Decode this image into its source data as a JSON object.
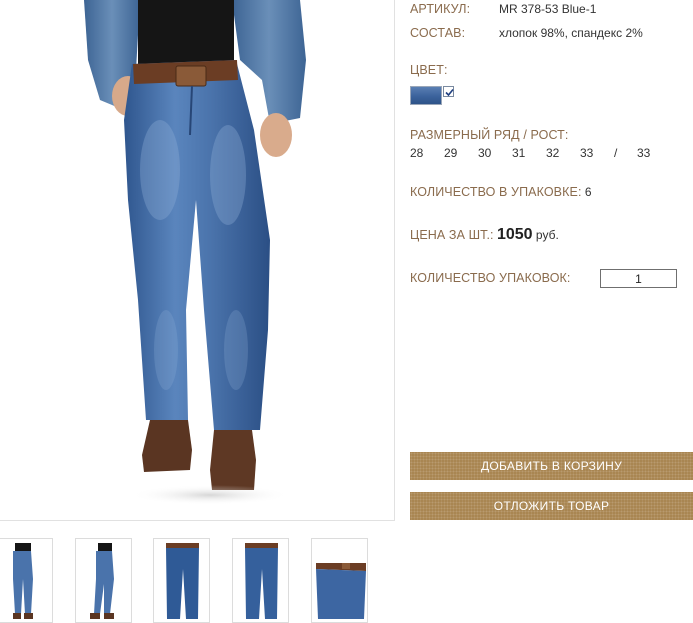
{
  "product": {
    "article_label": "АРТИКУЛ:",
    "article_value": "MR 378-53 Blue-1",
    "composition_label": "СОСТАВ:",
    "composition_value": "хлопок 98%, спандекс 2%",
    "color_label": "ЦВЕТ:",
    "color_swatch": "#3f66a0",
    "size_label": "РАЗМЕРНЫЙ РЯД / РОСТ:",
    "sizes": [
      "28",
      "29",
      "30",
      "31",
      "32",
      "33",
      "/",
      "33"
    ],
    "pack_qty_label": "КОЛИЧЕСТВО В УПАКОВКЕ:",
    "pack_qty_value": "6",
    "price_label": "ЦЕНА ЗА ШТ.:",
    "price_value": "1050",
    "price_currency": "руб.",
    "packs_label": "КОЛИЧЕСТВО УПАКОВОК:",
    "packs_value": "1"
  },
  "actions": {
    "add_to_cart": "ДОБАВИТЬ В КОРЗИНУ",
    "postpone": "ОТЛОЖИТЬ ТОВАР"
  },
  "colors": {
    "label": "#8a6b4d",
    "button": "#a8844f",
    "denim": "#3f66a0"
  }
}
